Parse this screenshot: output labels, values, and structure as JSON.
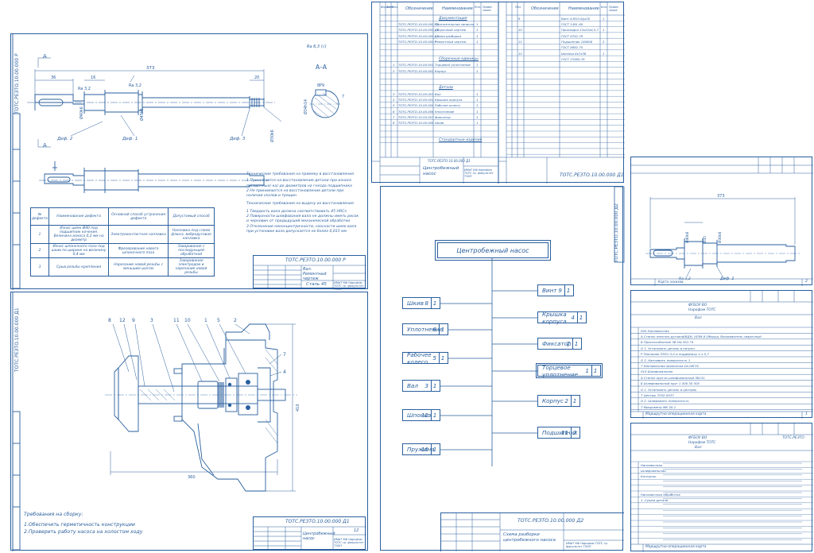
{
  "sheet_shaft": {
    "corner_code": "ТОТС.РЕЗТО.10.00.000 Р",
    "roughness": "Ra 6,3 (√)",
    "dims": {
      "overall": "373",
      "d36": "36",
      "d16": "16",
      "d20": "20",
      "d72": "72",
      "ra32a": "Ra 3,2",
      "ra32b": "Ra 3,2",
      "d40": "Ø40k6",
      "d30": "Ø30k6",
      "d35": "Ø35",
      "d45": "Ø45k6"
    },
    "section_label": "А–А",
    "section_dims": {
      "d1": "Ø34h14",
      "d2": "8Р9",
      "d3": "7"
    },
    "section_marks": {
      "a_top": "А",
      "a_bottom": "А"
    },
    "defects": {
      "d2": "Деф. 2",
      "d1": "Деф. 1",
      "d3": "Деф. 3"
    },
    "notes_title": "Технические требования на приемку в восстановления",
    "notes": [
      "1 Принимается на восстановление детали при износе",
      "посадочных(-ка) до диаметров на гнезда подшипника",
      "2 Не принимаются на восстановление детали при",
      "наличии сколов и трещин",
      "",
      "Технические требования на выдачу из восстановления",
      "",
      "1 Твердость вала должна соответствовать 45 HRCэ",
      "2 Поверхности шлифования вала не должны иметь рисок",
      "и черновин от предыдущей механической обработки",
      "3 Отклонение неконцентричности, соосности шеек вала",
      "при установке вала допускается не более 0,015 мм"
    ],
    "table_headers": [
      "№ дефекта",
      "Наименование дефекта",
      "Основной способ устранения дефекта",
      "Допустимый способ"
    ],
    "table_rows": [
      [
        "1",
        "Износ шеек Ø40 под подшипник кочения. Величина износа 0,2 мм на диаметр",
        "Электроконтактная наплавка",
        "Наплавка под слоем флюса, вибродуговая наплавка"
      ],
      [
        "2",
        "Износ шпоночного паза под шкив по ширине на величину 0,4 мм",
        "Фрезерование нового шпоночного паза",
        "Заваривание с последующей обработкой"
      ],
      [
        "3",
        "Срыв резьбы крепления",
        "Нарезание новой резьбы с меньшим шагом",
        "Заваривание электродом и нарезание новой резьбы"
      ]
    ],
    "title_code": "ТОТС.РЕЗТО.10.00.000 Р",
    "title_name": "Вал. Ремонтный чертеж",
    "title_material": "Сталь 45",
    "title_org": "ИМиТ КФ Нарофом ТОТС гр. факультет ТЭХП"
  },
  "sheet_pump": {
    "corner_code": "ТОТС.РЕЗТО.10.00.000 Д1",
    "callouts": [
      "8",
      "12",
      "9",
      "3",
      "11",
      "10",
      "1",
      "5",
      "2",
      "7",
      "4"
    ],
    "dim_width": "360",
    "dim_height": "410",
    "requirements_title": "Требования на сборку:",
    "requirements": [
      "1.Обеспечить герметичность конструкции",
      "2.Проверить работу насоса на холостом ходу"
    ],
    "title_code": "ТОТС.РЕЗТО.10.00.000 Д1",
    "title_name": "Центробежный насос",
    "title_sheet": "12",
    "title_org": "ИМиТ КФ Нарофом ТОТС гр. факультет ТЭХП"
  },
  "sheet_spec": {
    "headers": [
      "Формат",
      "Зона",
      "Поз.",
      "Обозначение",
      "Наименование",
      "Кол.",
      "Приме-чание"
    ],
    "sec_docs": "Документация",
    "docs": [
      [
        "ТОТС.РЕЗТО.10.00.000 ПЗ",
        "Пояснительная записка",
        "1"
      ],
      [
        "ТОТС.РЕЗТО.10.00.000 Д1",
        "Сборочный чертеж",
        "1"
      ],
      [
        "ТОТС.РЕЗТО.10.00.000 Д2",
        "Схема разборки",
        "1"
      ],
      [
        "ТОТС.РЕЗТО.10.00.000 Р",
        "Ремонтный чертеж",
        "1"
      ]
    ],
    "sec_units": "Сборочные единицы",
    "units": [
      [
        "ТОТС.РЕЗТО.10.00.001",
        "Торцевое уплотнение",
        "1"
      ],
      [
        "ТОТС.РЕЗТО.10.00.002",
        "Корпус",
        "1"
      ]
    ],
    "sec_parts": "Детали",
    "parts": [
      [
        "ТОТС.РЕЗТО.10.00.003",
        "Вал",
        "1"
      ],
      [
        "ТОТС.РЕЗТО.10.00.004",
        "Крышка корпуса",
        "1"
      ],
      [
        "ТОТС.РЕЗТО.10.00.005",
        "Рабочее колесо",
        "1"
      ],
      [
        "ТОТС.РЕЗТО.10.00.006",
        "Уплотнение",
        "1"
      ],
      [
        "ТОТС.РЕЗТО.10.00.007",
        "Фиксатор",
        "1"
      ],
      [
        "ТОТС.РЕЗТО.10.00.008",
        "Шкив",
        "1"
      ]
    ],
    "sec_std": "Стандартные изделия",
    "title_code_left": "ТОТС.РЕЗТО.10.00.000 Д1",
    "title_name_left": "Центробежный насос",
    "title_org": "ИМиТ КФ Нарофом ТОТС гр. факультет ТЭХП",
    "std_items": [
      [
        "9",
        "Винт А.М10-6gх20",
        "1"
      ],
      [
        "",
        "ГОСТ 1491-80",
        ""
      ],
      [
        "10",
        "Прокладка 13х22х6,5-7",
        "1"
      ],
      [
        "",
        "ГОСТ 8752-79",
        ""
      ],
      [
        "11",
        "Подшипник 180608",
        "2"
      ],
      [
        "",
        "ГОСТ 8882-75",
        ""
      ],
      [
        "12",
        "Шпонка 8х7х36",
        "1"
      ],
      [
        "",
        "ГОСТ 23360-78",
        ""
      ]
    ],
    "title_code_right": "ТОТС.РЕЗТО.10.00.000 Д1"
  },
  "sheet_scheme": {
    "corner_code": "ТОТС.РЕЗТО.10.00.000 Д2",
    "root": "Центробежный насос",
    "left_nodes": [
      [
        "Шкив",
        "8",
        "1"
      ],
      [
        "Уплотнение",
        "6",
        "1"
      ],
      [
        "Рабочее колесо",
        "5",
        "1"
      ],
      [
        "Вал",
        "3",
        "1"
      ],
      [
        "Шпонка",
        "12",
        "1"
      ],
      [
        "Пружина",
        "10",
        "1"
      ]
    ],
    "right_nodes": [
      [
        "Винт",
        "9",
        "1"
      ],
      [
        "Крышка корпуса",
        "4",
        "1"
      ],
      [
        "Фиксатор",
        "7",
        "1"
      ],
      [
        "Торцевое уплотнение",
        "1",
        "1"
      ],
      [
        "Корпус",
        "2",
        "1"
      ],
      [
        "Подшипник",
        "11",
        "2"
      ]
    ],
    "title_code": "ТОТС.РЕЗТО.10.00.000 Д2",
    "title_name": "Схема разборки центробежного насоса",
    "title_org": "ИМиТ КФ Нарофом ТОТС гр. факультет ТЭХП"
  },
  "sheet_mini": {
    "dim_overall": "373",
    "ra": "Ra 3,2",
    "d40": "Ø40k6",
    "d1": "Ø35",
    "d2": "Ø30k6",
    "defect": "Деф. 1",
    "footer": "Карта эскизов",
    "sheet_no": "2"
  },
  "sheet_route1": {
    "org": "ФГБОУ ВО",
    "inst": "Нарофом ТОТС",
    "part": "Вал",
    "rows": [
      "005 Наплавочная",
      "А Станок электро-дуговой(ВДУ) 163М-8  Оборуд. Выпрямитель сварочный",
      "Б Приспособление 3В Нм 301 Г8",
      "О 1. Установить деталь в патрон",
      "Р Паяльник ПЭ21-3,0 и поддержку 4 х 0,7",
      "О 2. Наплавить поверхность 1",
      "Т Наплавочная проволока Св-08Г2С",
      "010 Шлифовальная",
      "А Станок кругло-шлифовальный 3Б151",
      "Б Шлифовальный круг 1 500 50 305",
      "О 1. Установить деталь в центрах",
      "Т Центры 7032-0037",
      "О 2. Шлифовать поверхность",
      "Т Микрометр МК 50-1"
    ],
    "footer": "Маршрутно-операционная карта",
    "sheet_no": "1"
  },
  "sheet_route2": {
    "org": "ФГБОУ ВО",
    "inst": "Нарофом ТОТС",
    "part": "Вал",
    "code": "ТОТС.РЕЗТО",
    "rows": [
      "Наплавочная",
      "Шлифовальная",
      "Контроль",
      "Наплавочная обработка",
      "1. Сушка детали"
    ],
    "footer": "Маршрутно-операционная карта"
  }
}
